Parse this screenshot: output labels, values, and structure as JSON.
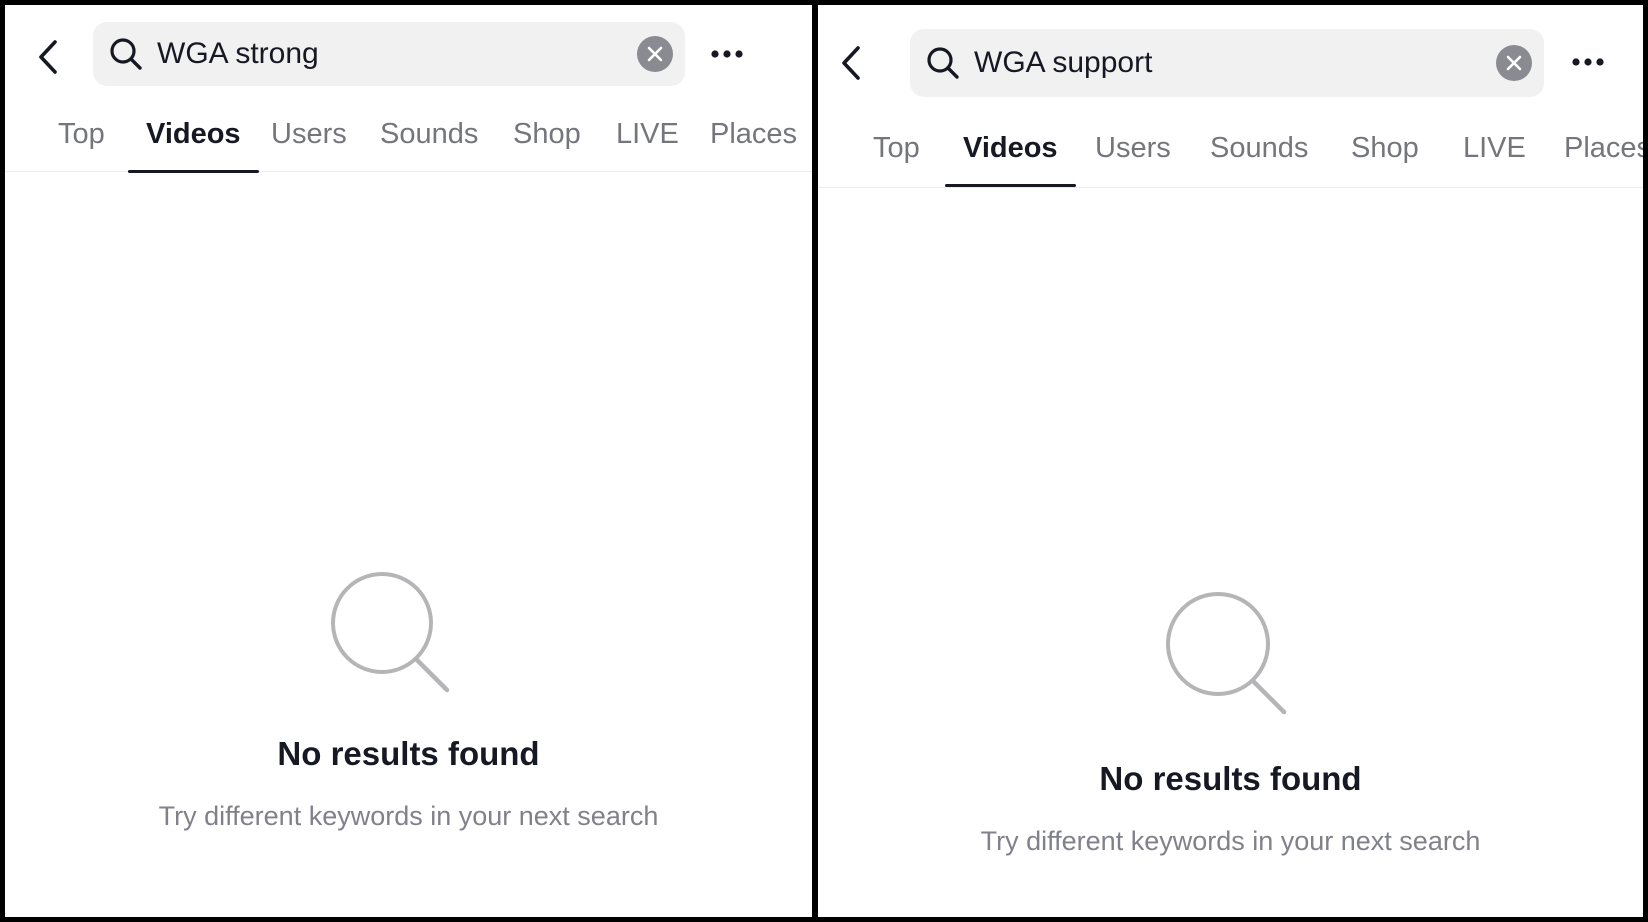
{
  "panels": [
    {
      "search": {
        "query": "WGA strong"
      },
      "tabs": [
        "Top",
        "Videos",
        "Users",
        "Sounds",
        "Shop",
        "LIVE",
        "Places"
      ],
      "active_tab": "Videos",
      "empty_state": {
        "title": "No results found",
        "subtitle": "Try different keywords in your next search"
      }
    },
    {
      "search": {
        "query": "WGA support"
      },
      "tabs": [
        "Top",
        "Videos",
        "Users",
        "Sounds",
        "Shop",
        "LIVE",
        "Places"
      ],
      "active_tab": "Videos",
      "empty_state": {
        "title": "No results found",
        "subtitle": "Try different keywords in your next search"
      }
    }
  ],
  "icons": {
    "back": "chevron-left-icon",
    "search": "search-icon",
    "clear": "close-circle-icon",
    "more": "more-horizontal-icon",
    "empty": "search-empty-icon"
  },
  "colors": {
    "text_primary": "#161823",
    "text_secondary": "#75767c",
    "search_bg": "#f1f1f2",
    "clear_bg": "#8a8b91",
    "empty_icon": "#b5b5b8"
  }
}
